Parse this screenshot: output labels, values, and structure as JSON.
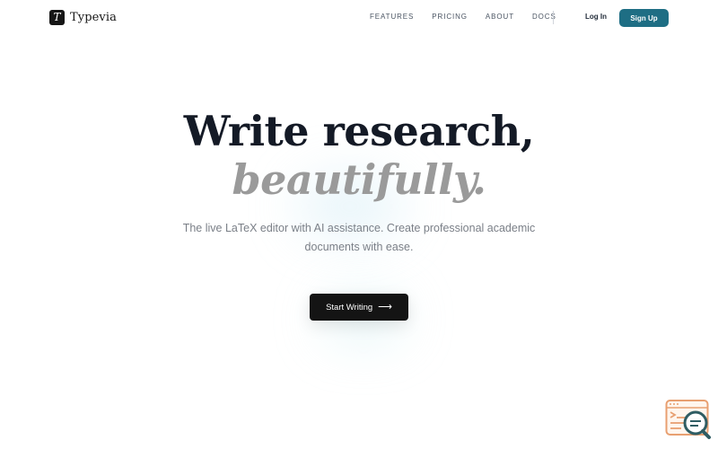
{
  "brand": {
    "logo_glyph": "T",
    "name": "Typevia"
  },
  "nav": {
    "links": [
      "FEATURES",
      "PRICING",
      "ABOUT",
      "DOCS"
    ],
    "login_label": "Log In",
    "signup_label": "Sign Up"
  },
  "hero": {
    "title": "Write research,",
    "title_emphasis": "beautifully.",
    "description": "The live LaTeX editor with AI assistance. Create professional academic documents with ease.",
    "cta_label": "Start Writing",
    "cta_icon": "arrow-right-icon",
    "cta_arrow": "⟶"
  },
  "widget": {
    "icon": "chat-search-icon"
  },
  "colors": {
    "accent": "#1e6e84",
    "primary_text": "#141a26",
    "muted_title": "#9a9a9a",
    "cta_background": "#141414",
    "widget_orange": "#e8a071",
    "widget_teal": "#2f5d63"
  }
}
